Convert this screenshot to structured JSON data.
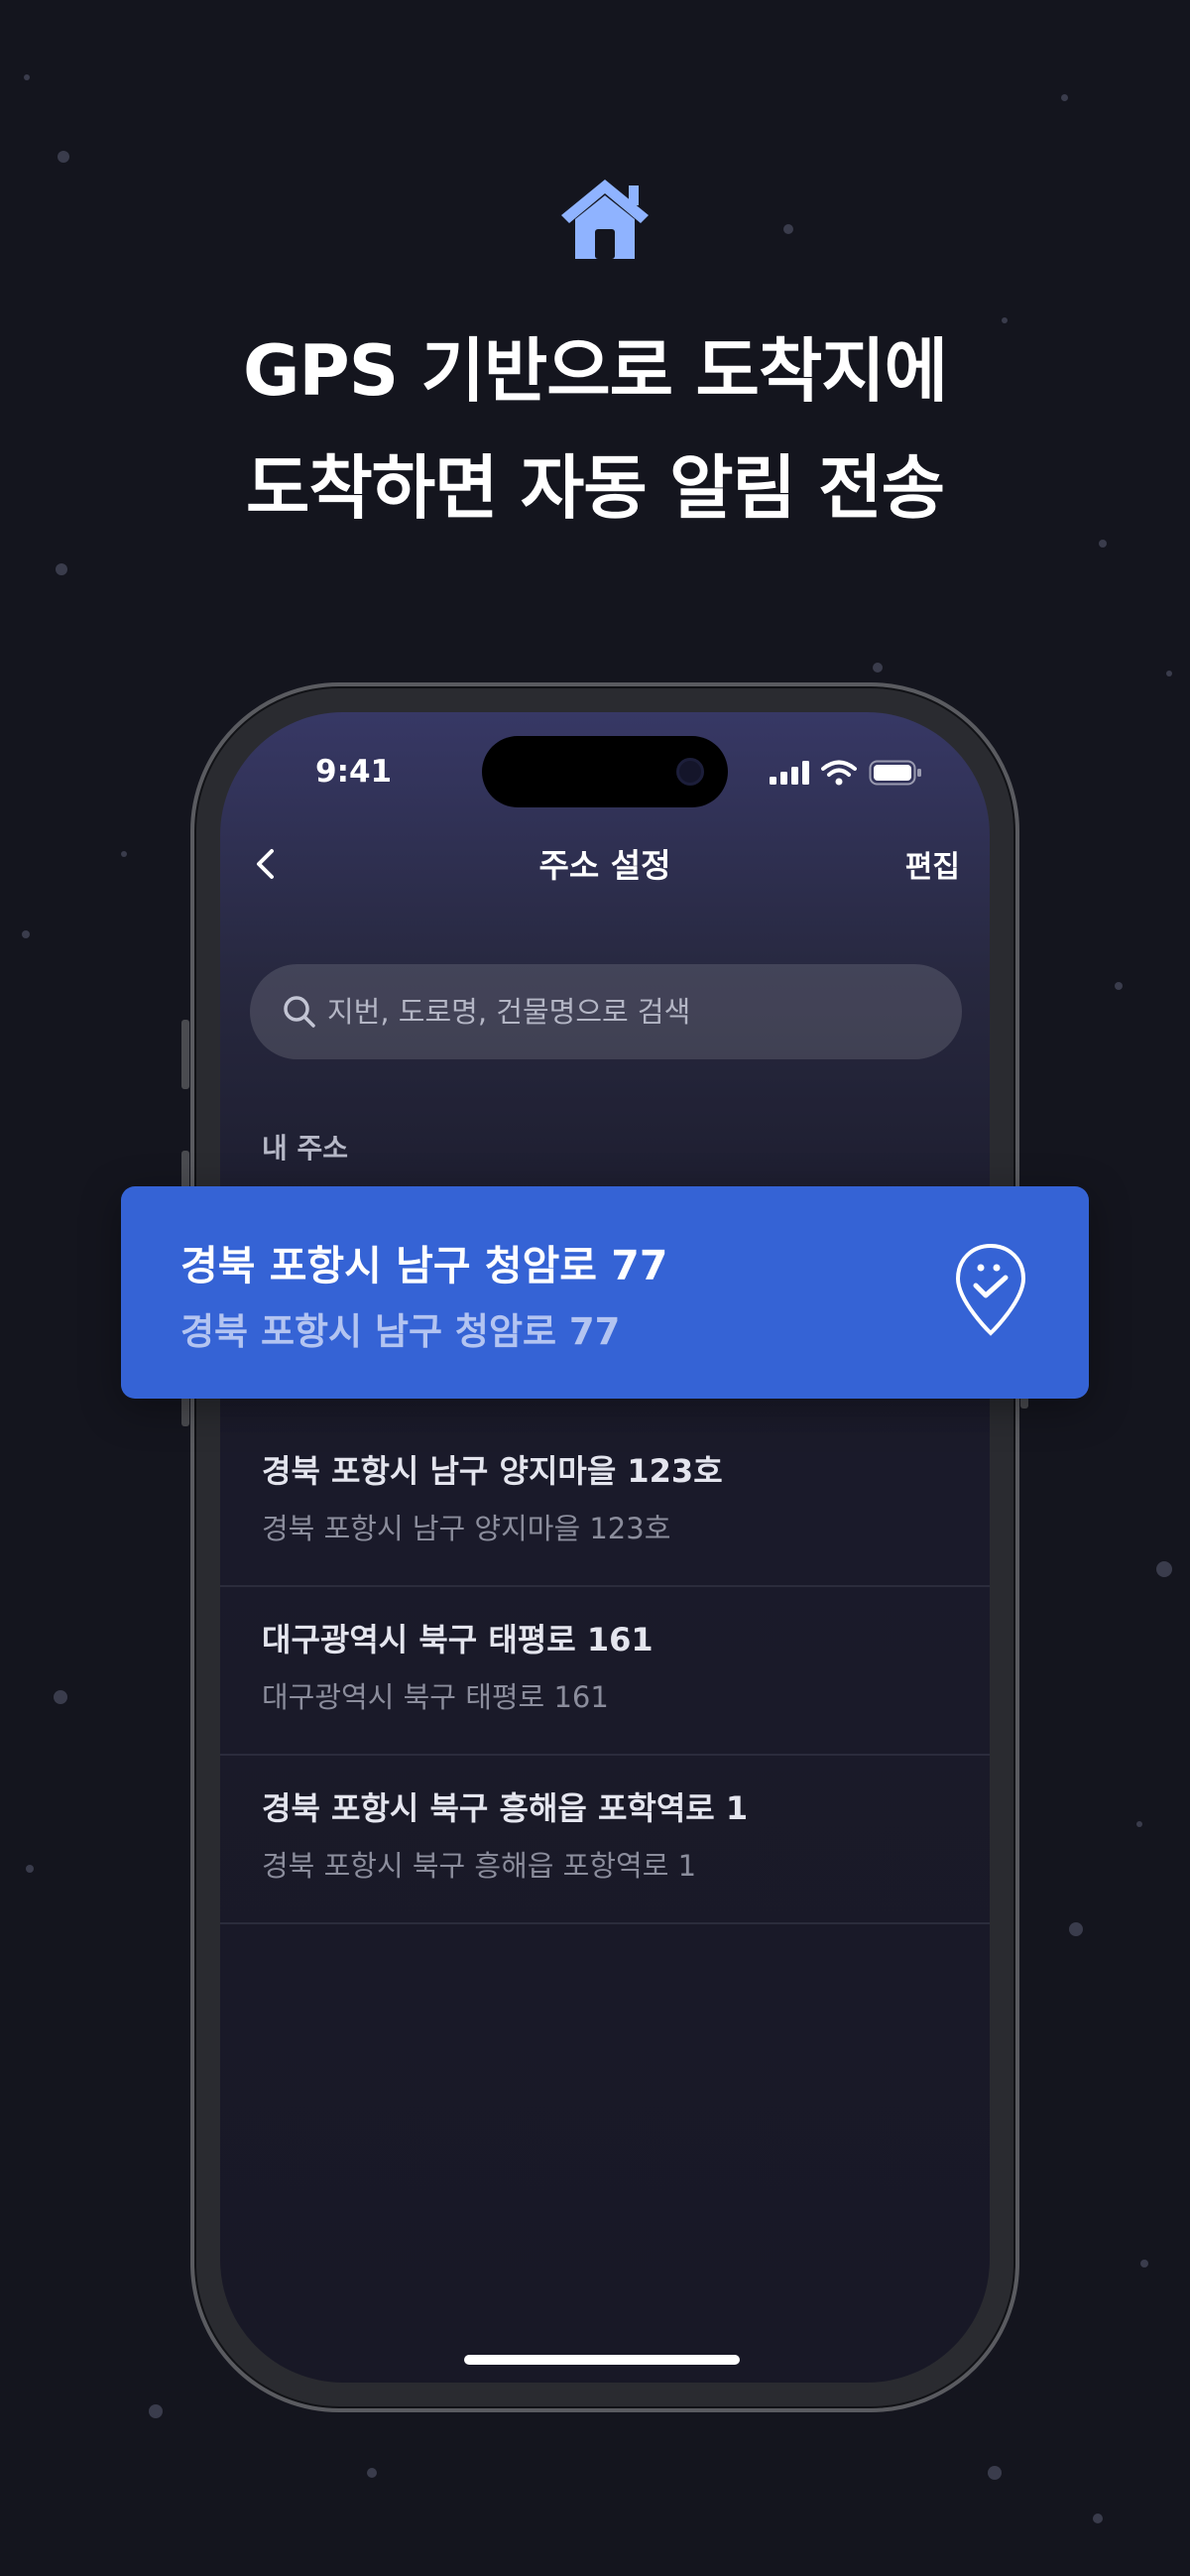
{
  "headline": {
    "line1": "GPS 기반으로 도착지에",
    "line2": "도착하면 자동 알림 전송"
  },
  "status_bar": {
    "time": "9:41"
  },
  "nav": {
    "title": "주소 설정",
    "edit_label": "편집"
  },
  "search": {
    "placeholder": "지번, 도로명, 건물명으로 검색"
  },
  "section": {
    "label": "내 주소"
  },
  "selected_address": {
    "title": "경북 포항시 남구 청암로 77",
    "sub": "경북 포항시 남구 청암로 77"
  },
  "addresses": [
    {
      "title": "경북 포항시 남구 양지마을 123호",
      "sub": "경북 포항시 남구 양지마을 123호"
    },
    {
      "title": "대구광역시 북구 태평로 161",
      "sub": "대구광역시 북구 태평로 161"
    },
    {
      "title": "경북 포항시 북구 흥해읍 포학역로 1",
      "sub": "경북 포항시 북구 흥해읍 포항역로 1"
    }
  ],
  "icons": {
    "hero": "house-icon",
    "back": "chevron-left-icon",
    "search": "search-icon",
    "pin": "location-check-pin-icon"
  },
  "colors": {
    "background": "#14151e",
    "accent": "#3563d5",
    "hero_icon": "#8fb3ff"
  }
}
